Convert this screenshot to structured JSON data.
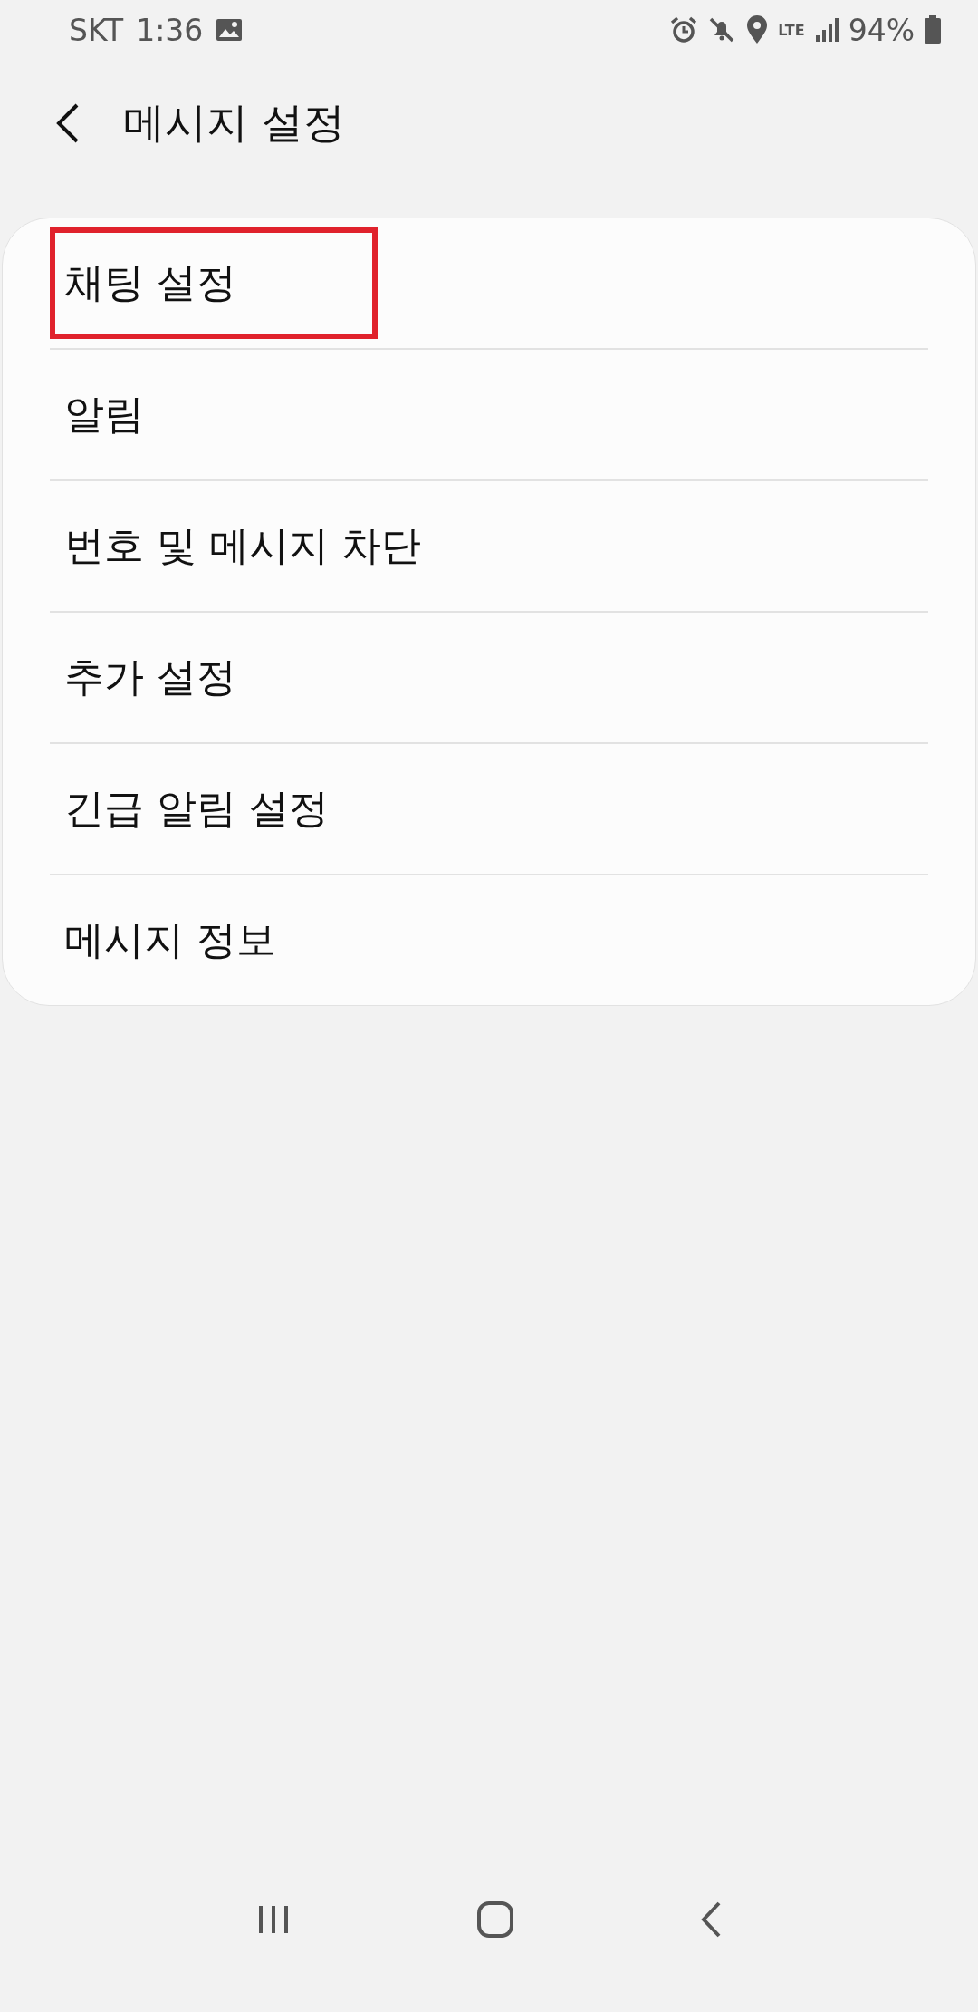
{
  "status_bar": {
    "carrier": "SKT",
    "time": "1:36",
    "lte": "LTE",
    "battery": "94%"
  },
  "header": {
    "title": "메시지 설정"
  },
  "items": [
    {
      "label": "채팅 설정",
      "highlighted": true
    },
    {
      "label": "알림",
      "highlighted": false
    },
    {
      "label": "번호 및 메시지 차단",
      "highlighted": false
    },
    {
      "label": "추가 설정",
      "highlighted": false
    },
    {
      "label": "긴급 알림 설정",
      "highlighted": false
    },
    {
      "label": "메시지 정보",
      "highlighted": false
    }
  ]
}
